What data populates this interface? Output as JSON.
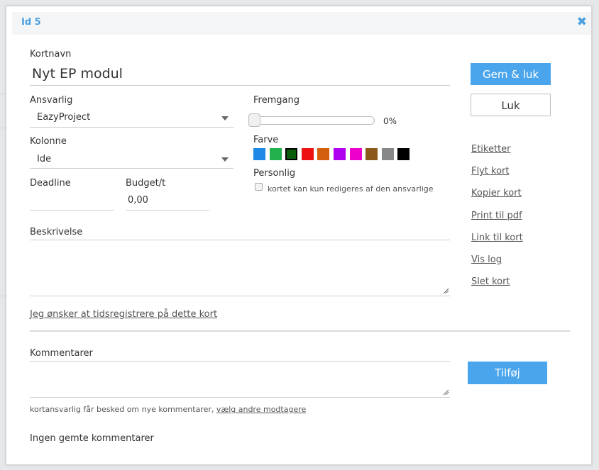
{
  "modal": {
    "id_label": "Id 5",
    "close_symbol": "✖"
  },
  "fields": {
    "card_name_label": "Kortnavn",
    "card_name_value": "Nyt EP modul",
    "responsible_label": "Ansvarlig",
    "responsible_value": "EazyProject",
    "column_label": "Kolonne",
    "column_value": "Ide",
    "deadline_label": "Deadline",
    "deadline_value": "",
    "budget_label": "Budget/t",
    "budget_value": "0,00",
    "progress_label": "Fremgang",
    "progress_value": 0,
    "progress_text": "0%",
    "color_label": "Farve",
    "personal_label": "Personlig",
    "personal_checkbox_text": "kortet kan kun redigeres af den ansvarlige",
    "personal_checked": false,
    "description_label": "Beskrivelse",
    "time_register_link": "Jeg ønsker at tidsregistrere på dette kort",
    "comments_label": "Kommentarer",
    "comments_notice": "kortansvarlig får besked om nye kommentarer,",
    "comments_notice_link": "vælg andre modtagere",
    "no_comments": "Ingen gemte kommentarer"
  },
  "colors": [
    "#1e88e5",
    "#22b14c",
    "#0b5d0b",
    "#ee1111",
    "#d35f0e",
    "#b000f0",
    "#ee00cc",
    "#8b5a1a",
    "#888888",
    "#000000"
  ],
  "selected_color_index": 2,
  "buttons": {
    "save_close": "Gem & luk",
    "close": "Luk",
    "add": "Tilføj"
  },
  "side_links": [
    "Etiketter",
    "Flyt kort",
    "Kopier kort",
    "Print til pdf",
    "Link til kort",
    "Vis log",
    "Slet kort"
  ]
}
